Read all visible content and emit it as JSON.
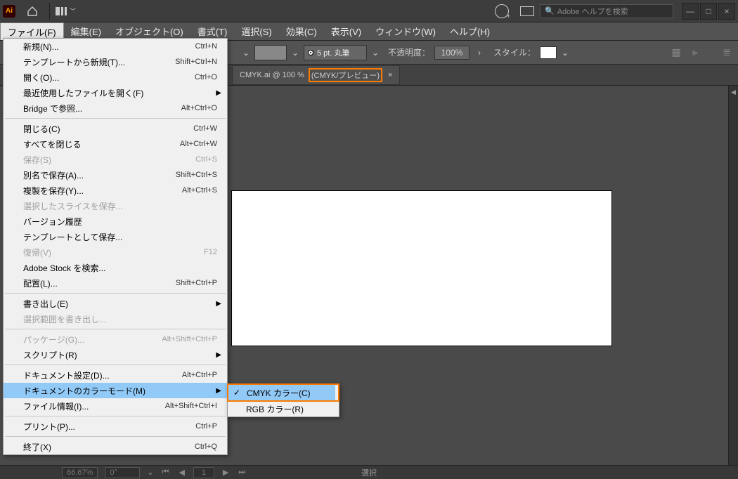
{
  "titlebar": {
    "logo": "Ai",
    "search_placeholder": "Adobe ヘルプを検索"
  },
  "menubar": {
    "items": [
      "ファイル(F)",
      "編集(E)",
      "オブジェクト(O)",
      "書式(T)",
      "選択(S)",
      "効果(C)",
      "表示(V)",
      "ウィンドウ(W)",
      "ヘルプ(H)"
    ]
  },
  "controlbar": {
    "stroke_label": "5 pt. 丸筆",
    "opacity_label": "不透明度：",
    "opacity_value": "100%",
    "style_label": "スタイル："
  },
  "doc_tab": {
    "name": "CMYK.ai @ 100 %",
    "mode": "(CMYK/プレビュー)",
    "close": "×"
  },
  "file_menu": [
    {
      "l": "新規(N)...",
      "s": "Ctrl+N"
    },
    {
      "l": "テンプレートから新規(T)...",
      "s": "Shift+Ctrl+N"
    },
    {
      "l": "開く(O)...",
      "s": "Ctrl+O"
    },
    {
      "l": "最近使用したファイルを開く(F)",
      "sub": true
    },
    {
      "l": "Bridge で参照...",
      "s": "Alt+Ctrl+O"
    },
    {
      "sep": true
    },
    {
      "l": "閉じる(C)",
      "s": "Ctrl+W"
    },
    {
      "l": "すべてを閉じる",
      "s": "Alt+Ctrl+W"
    },
    {
      "l": "保存(S)",
      "s": "Ctrl+S",
      "d": true
    },
    {
      "l": "別名で保存(A)...",
      "s": "Shift+Ctrl+S"
    },
    {
      "l": "複製を保存(Y)...",
      "s": "Alt+Ctrl+S"
    },
    {
      "l": "選択したスライスを保存...",
      "d": true
    },
    {
      "l": "バージョン履歴"
    },
    {
      "l": "テンプレートとして保存..."
    },
    {
      "l": "復帰(V)",
      "s": "F12",
      "d": true
    },
    {
      "l": "Adobe Stock を検索..."
    },
    {
      "l": "配置(L)...",
      "s": "Shift+Ctrl+P"
    },
    {
      "sep": true
    },
    {
      "l": "書き出し(E)",
      "sub": true
    },
    {
      "l": "選択範囲を書き出し...",
      "d": true
    },
    {
      "sep": true
    },
    {
      "l": "パッケージ(G)...",
      "s": "Alt+Shift+Ctrl+P",
      "d": true
    },
    {
      "l": "スクリプト(R)",
      "sub": true
    },
    {
      "sep": true
    },
    {
      "l": "ドキュメント設定(D)...",
      "s": "Alt+Ctrl+P"
    },
    {
      "l": "ドキュメントのカラーモード(M)",
      "sub": true,
      "sel": true
    },
    {
      "l": "ファイル情報(I)...",
      "s": "Alt+Shift+Ctrl+I"
    },
    {
      "sep": true
    },
    {
      "l": "プリント(P)...",
      "s": "Ctrl+P"
    },
    {
      "sep": true
    },
    {
      "l": "終了(X)",
      "s": "Ctrl+Q"
    }
  ],
  "submenu": {
    "cmyk": "CMYK カラー(C)",
    "rgb": "RGB カラー(R)"
  },
  "statusbar": {
    "zoom": "66.67%",
    "angle": "0°",
    "page": "1",
    "label": "選択"
  }
}
